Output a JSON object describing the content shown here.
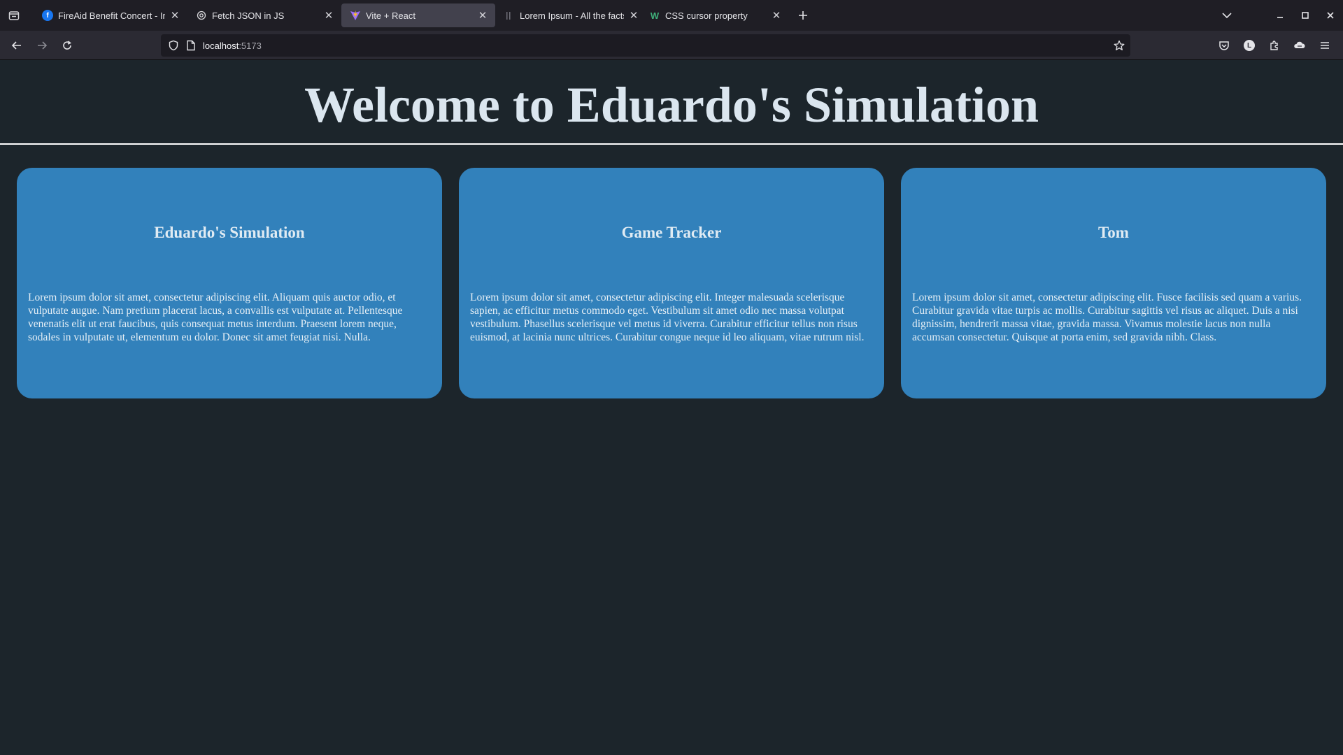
{
  "browser": {
    "tabs": [
      {
        "title": "FireAid Benefit Concert - Intuit D",
        "favicon": "facebook-icon",
        "active": false
      },
      {
        "title": "Fetch JSON in JS",
        "favicon": "openai-icon",
        "active": false
      },
      {
        "title": "Vite + React",
        "favicon": "vite-icon",
        "active": true
      },
      {
        "title": "Lorem Ipsum - All the facts - Lipsum",
        "favicon": "lipsum-icon",
        "active": false
      },
      {
        "title": "CSS cursor property",
        "favicon": "w3schools-icon",
        "active": false
      }
    ],
    "address": {
      "host": "localhost",
      "port": ":5173"
    },
    "accent_color": "#42414d"
  },
  "page": {
    "title": "Welcome to Eduardo's Simulation",
    "cards": [
      {
        "heading": "Eduardo's Simulation",
        "body": "Lorem ipsum dolor sit amet, consectetur adipiscing elit. Aliquam quis auctor odio, et vulputate augue. Nam pretium placerat lacus, a convallis est vulputate at. Pellentesque venenatis elit ut erat faucibus, quis consequat metus interdum. Praesent lorem neque, sodales in vulputate ut, elementum eu dolor. Donec sit amet feugiat nisi. Nulla."
      },
      {
        "heading": "Game Tracker",
        "body": "Lorem ipsum dolor sit amet, consectetur adipiscing elit. Integer malesuada scelerisque sapien, ac efficitur metus commodo eget. Vestibulum sit amet odio nec massa volutpat vestibulum. Phasellus scelerisque vel metus id viverra. Curabitur efficitur tellus non risus euismod, at lacinia nunc ultrices. Curabitur congue neque id leo aliquam, vitae rutrum nisl."
      },
      {
        "heading": "Tom",
        "body": "Lorem ipsum dolor sit amet, consectetur adipiscing elit. Fusce facilisis sed quam a varius. Curabitur gravida vitae turpis ac mollis. Curabitur sagittis vel risus ac aliquet. Duis a nisi dignissim, hendrerit massa vitae, gravida massa. Vivamus molestie lacus non nulla accumsan consectetur. Quisque at porta enim, sed gravida nibh. Class."
      }
    ],
    "card_color": "#3281bb",
    "background_color": "#1c252b"
  }
}
